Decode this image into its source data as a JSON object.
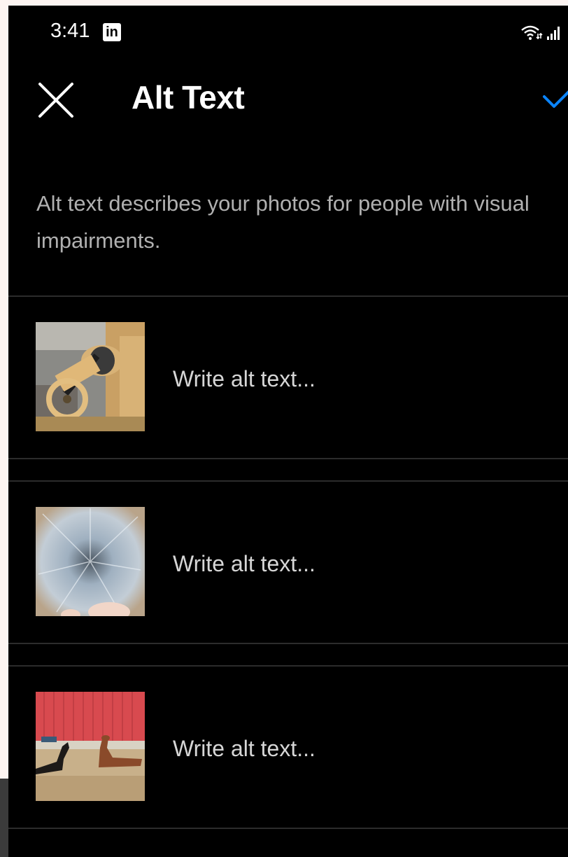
{
  "status_bar": {
    "time": "3:41",
    "app_badge": "in",
    "icons": [
      "wifi-icon",
      "signal-icon"
    ]
  },
  "header": {
    "title": "Alt Text",
    "close_icon": "close-icon",
    "done_icon": "check-icon"
  },
  "description": "Alt text describes your photos for people with visual impairments.",
  "photos": [
    {
      "placeholder": "Write alt text...",
      "thumbnail": "spinning-wheel-photo"
    },
    {
      "placeholder": "Write alt text...",
      "thumbnail": "fiber-fleece-photo"
    },
    {
      "placeholder": "Write alt text...",
      "thumbnail": "alpacas-red-barn-photo"
    }
  ],
  "colors": {
    "background": "#000000",
    "accent": "#0a84ff",
    "description_text": "#b0b0b0",
    "placeholder_text": "#d6d6d6",
    "divider": "#2c2c2c"
  }
}
